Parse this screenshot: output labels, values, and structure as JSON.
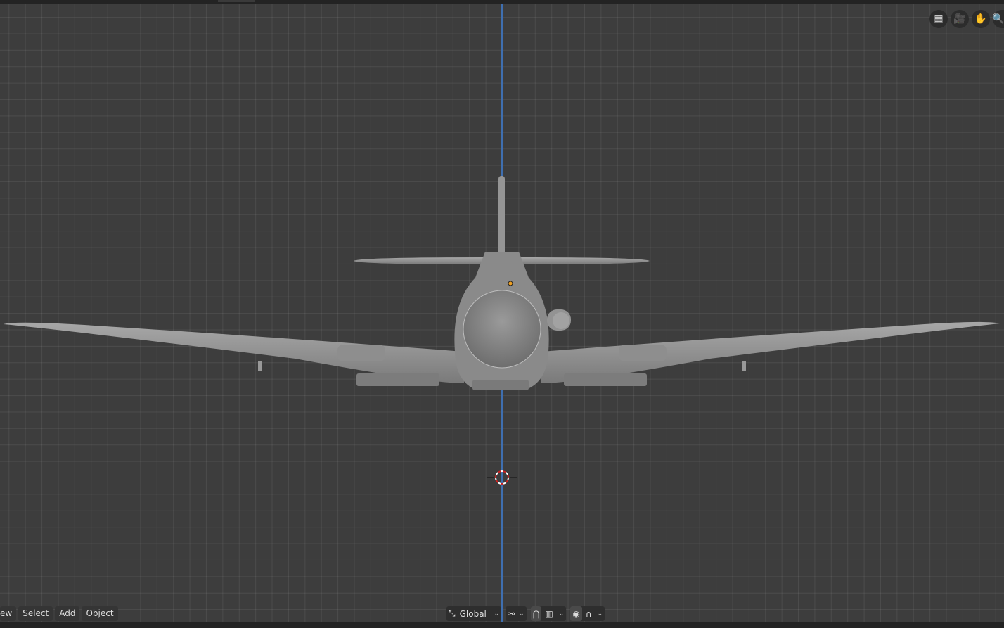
{
  "viewport": {
    "axis_colors": {
      "z": "#3f6fb0",
      "y": "#6f8c3a"
    },
    "origin_marker": "3d-cursor"
  },
  "nav_gizmo": [
    {
      "icon": "grid-icon"
    },
    {
      "icon": "camera-icon"
    },
    {
      "icon": "hand-pan-icon"
    },
    {
      "icon": "zoom-icon"
    }
  ],
  "header": {
    "menus": [
      "ew",
      "Select",
      "Add",
      "Object"
    ],
    "transform_orientation": "Global",
    "pivot_icon": "pivot-icon",
    "snap_icon": "magnet-icon",
    "snap_target_icon": "snap-increment-icon",
    "proportional_icon": "proportional-editing-icon",
    "falloff_icon": "falloff-curve-icon"
  }
}
